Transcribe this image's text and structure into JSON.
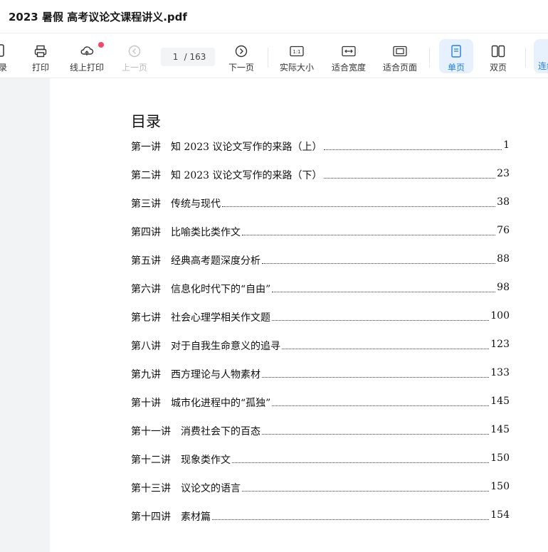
{
  "window": {
    "title": "2023 暑假 高考议论文课程讲义.pdf"
  },
  "toolbar": {
    "left_partial_label": "录",
    "print": "打印",
    "online_print": "线上打印",
    "prev_page": "上一页",
    "page_current": "1",
    "page_total_text": "/ 163",
    "next_page": "下一页",
    "actual_size": "实际大小",
    "fit_width": "适合宽度",
    "fit_page": "适合页面",
    "single_page": "单页",
    "double_page": "双页",
    "right_partial_label": "连续"
  },
  "colors": {
    "accent": "#1e7ff0",
    "active_bg": "#e6f1fd",
    "notify_dot": "#f5456b"
  },
  "toc": {
    "heading": "目录",
    "items": [
      {
        "lecture": "第一讲",
        "title": "知 2023 议论文写作的来路（上）",
        "page": "1"
      },
      {
        "lecture": "第二讲",
        "title": "知 2023 议论文写作的来路（下）",
        "page": "23"
      },
      {
        "lecture": "第三讲",
        "title": "传统与现代",
        "page": "38"
      },
      {
        "lecture": "第四讲",
        "title": "比喻类比类作文",
        "page": "76"
      },
      {
        "lecture": "第五讲",
        "title": "经典高考题深度分析",
        "page": "88"
      },
      {
        "lecture": "第六讲",
        "title": "信息化时代下的“自由”",
        "page": "98"
      },
      {
        "lecture": "第七讲",
        "title": "社会心理学相关作文题",
        "page": "100"
      },
      {
        "lecture": "第八讲",
        "title": "对于自我生命意义的追寻",
        "page": "123"
      },
      {
        "lecture": "第九讲",
        "title": "西方理论与人物素材",
        "page": "133"
      },
      {
        "lecture": "第十讲",
        "title": "城市化进程中的“孤独”",
        "page": "145"
      },
      {
        "lecture": "第十一讲",
        "title": "消费社会下的百态",
        "page": "145"
      },
      {
        "lecture": "第十二讲",
        "title": "现象类作文",
        "page": "150"
      },
      {
        "lecture": "第十三讲",
        "title": "议论文的语言",
        "page": "150"
      },
      {
        "lecture": "第十四讲",
        "title": "素材篇",
        "page": "154"
      }
    ]
  }
}
